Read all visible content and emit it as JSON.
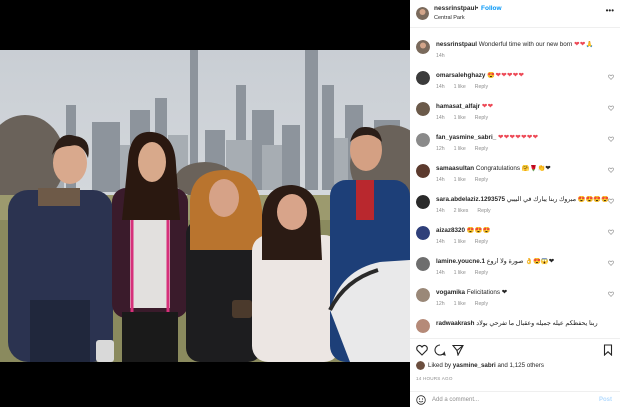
{
  "post": {
    "username": "nessrinstpaul",
    "separator": "•",
    "follow_label": "Follow",
    "location": "Central Park",
    "more_label": "•••"
  },
  "caption": {
    "username": "nessrinstpaul",
    "text": "Wonderful time with our new born",
    "emoji": "❤❤🙏",
    "time": "14h"
  },
  "comments": [
    {
      "username": "omarsalehghazy",
      "text": "😍❤❤❤❤❤",
      "time": "14h",
      "likes": "1 like",
      "reply": "Reply"
    },
    {
      "username": "hamasat_alfajr",
      "text": "❤❤",
      "time": "14h",
      "likes": "1 like",
      "reply": "Reply"
    },
    {
      "username": "fan_yasmine_sabri_",
      "text": "❤❤❤❤❤❤❤",
      "time": "12h",
      "likes": "1 like",
      "reply": "Reply"
    },
    {
      "username": "samaasultan",
      "text": "Congratulations 🤗🌹👏❤",
      "time": "14h",
      "likes": "1 like",
      "reply": "Reply"
    },
    {
      "username": "sara.abdelaziz.1293575",
      "text": "مبروك ربنا يبارك في البيبي 😍😍😍😍",
      "time": "14h",
      "likes": "2 likes",
      "reply": "Reply"
    },
    {
      "username": "aizaz8320",
      "text": "😍😍😍",
      "time": "14h",
      "likes": "1 like",
      "reply": "Reply"
    },
    {
      "username": "lamine.youcne.1",
      "text": "صورة ولا أروع 👌😍😱❤",
      "time": "14h",
      "likes": "1 like",
      "reply": "Reply"
    },
    {
      "username": "vogamika",
      "text": "Felicitations ❤",
      "time": "12h",
      "likes": "1 like",
      "reply": "Reply"
    },
    {
      "username": "radwaakrash",
      "text": "ربنا يحفظكم عيله جميله وعقبال ما تفرحي بولاد",
      "time": "",
      "likes": "",
      "reply": ""
    }
  ],
  "actions": {
    "liked_by_prefix": "Liked by",
    "liked_by_user": "yasmine_sabri",
    "liked_by_suffix": "and 1,125 others",
    "time_ago": "14 HOURS AGO",
    "add_comment_placeholder": "Add a comment...",
    "post_label": "Post"
  },
  "icons": [
    "heart-icon",
    "comment-icon",
    "share-icon",
    "bookmark-icon",
    "emoji-icon",
    "more-icon"
  ],
  "colors": {
    "follow_blue": "#0095f6",
    "heart_red": "#ed4956",
    "muted": "#8e8e8e",
    "post_disabled": "#b3dbff"
  }
}
